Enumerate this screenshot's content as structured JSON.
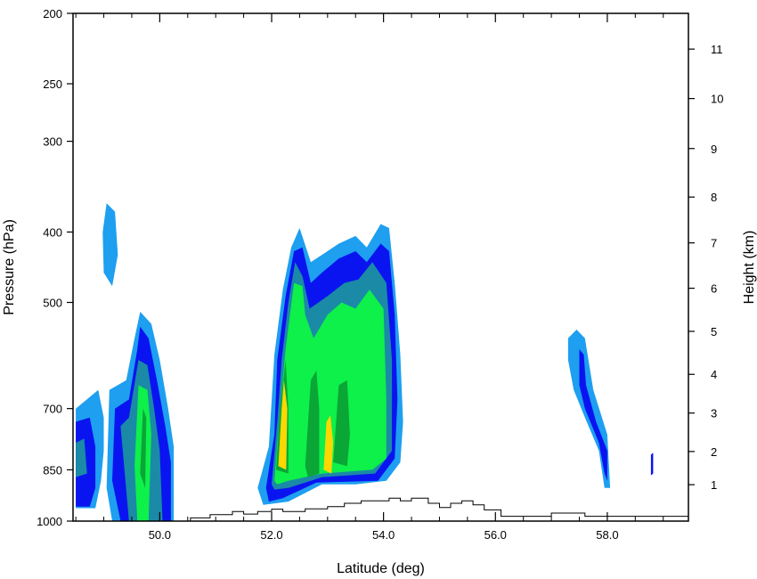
{
  "chart_data": {
    "type": "heatmap",
    "title": "",
    "xlabel": "Latitude (deg)",
    "ylabel": "Pressure (hPa)",
    "y2label": "Height (km)",
    "xlim": [
      48.45,
      59.45
    ],
    "ylim": [
      1000,
      200
    ],
    "y_scale": "log",
    "x_ticks": [
      {
        "value": 50,
        "label": "50.0"
      },
      {
        "value": 52,
        "label": "52.0"
      },
      {
        "value": 54,
        "label": "54.0"
      },
      {
        "value": 56,
        "label": "56.0"
      },
      {
        "value": 58,
        "label": "58.0"
      }
    ],
    "y_ticks": [
      {
        "value": 1000,
        "label": "1000"
      },
      {
        "value": 850,
        "label": "850"
      },
      {
        "value": 700,
        "label": "700"
      },
      {
        "value": 500,
        "label": "500"
      },
      {
        "value": 400,
        "label": "400"
      },
      {
        "value": 300,
        "label": "300"
      },
      {
        "value": 250,
        "label": "250"
      },
      {
        "value": 200,
        "label": "200"
      }
    ],
    "y2_ticks": [
      {
        "value": 1,
        "label": "1"
      },
      {
        "value": 2,
        "label": "2"
      },
      {
        "value": 3,
        "label": "3"
      },
      {
        "value": 4,
        "label": "4"
      },
      {
        "value": 5,
        "label": "5"
      },
      {
        "value": 6,
        "label": "6"
      },
      {
        "value": 7,
        "label": "7"
      },
      {
        "value": 8,
        "label": "8"
      },
      {
        "value": 9,
        "label": "9"
      },
      {
        "value": 10,
        "label": "10"
      },
      {
        "value": 11,
        "label": "11"
      }
    ],
    "height_pressure_map": [
      {
        "km": 1,
        "hPa": 891
      },
      {
        "km": 2,
        "hPa": 802
      },
      {
        "km": 3,
        "hPa": 710
      },
      {
        "km": 4,
        "hPa": 628
      },
      {
        "km": 5,
        "hPa": 548
      },
      {
        "km": 6,
        "hPa": 478
      },
      {
        "km": 7,
        "hPa": 414
      },
      {
        "km": 8,
        "hPa": 358
      },
      {
        "km": 9,
        "hPa": 307
      },
      {
        "km": 10,
        "hPa": 262
      },
      {
        "km": 11,
        "hPa": 224
      }
    ],
    "fill_levels": [
      {
        "color": "#1e9ff0"
      },
      {
        "color": "#0a14f0"
      },
      {
        "color": "#1a8aa6"
      },
      {
        "color": "#0ef04a"
      },
      {
        "color": "#0aa636"
      },
      {
        "color": "#ffd700"
      }
    ],
    "regions": [
      {
        "level": 0,
        "points": [
          [
            48.5,
            700
          ],
          [
            48.9,
            660
          ],
          [
            49.0,
            720
          ],
          [
            49.0,
            800
          ],
          [
            48.95,
            880
          ],
          [
            48.85,
            960
          ],
          [
            48.5,
            960
          ]
        ]
      },
      {
        "level": 1,
        "points": [
          [
            48.5,
            730
          ],
          [
            48.75,
            720
          ],
          [
            48.85,
            790
          ],
          [
            48.85,
            900
          ],
          [
            48.75,
            955
          ],
          [
            48.5,
            955
          ]
        ]
      },
      {
        "level": 2,
        "points": [
          [
            48.5,
            780
          ],
          [
            48.65,
            770
          ],
          [
            48.7,
            860
          ],
          [
            48.5,
            870
          ]
        ]
      },
      {
        "level": 0,
        "points": [
          [
            49.05,
            365
          ],
          [
            49.2,
            375
          ],
          [
            49.25,
            430
          ],
          [
            49.15,
            475
          ],
          [
            49.0,
            455
          ],
          [
            48.98,
            400
          ]
        ]
      },
      {
        "level": 0,
        "points": [
          [
            49.1,
            660
          ],
          [
            49.4,
            640
          ],
          [
            49.55,
            560
          ],
          [
            49.65,
            515
          ],
          [
            49.85,
            535
          ],
          [
            50.0,
            600
          ],
          [
            50.15,
            700
          ],
          [
            50.25,
            790
          ],
          [
            50.25,
            1000
          ],
          [
            49.15,
            1000
          ],
          [
            49.05,
            900
          ]
        ]
      },
      {
        "level": 1,
        "points": [
          [
            49.2,
            700
          ],
          [
            49.45,
            680
          ],
          [
            49.6,
            580
          ],
          [
            49.65,
            540
          ],
          [
            49.8,
            560
          ],
          [
            49.95,
            640
          ],
          [
            50.1,
            740
          ],
          [
            50.2,
            830
          ],
          [
            50.2,
            1000
          ],
          [
            49.3,
            1000
          ],
          [
            49.15,
            880
          ]
        ]
      },
      {
        "level": 2,
        "points": [
          [
            49.3,
            740
          ],
          [
            49.45,
            720
          ],
          [
            49.62,
            600
          ],
          [
            49.78,
            610
          ],
          [
            49.9,
            700
          ],
          [
            50.0,
            800
          ],
          [
            50.05,
            1000
          ],
          [
            49.45,
            1000
          ]
        ]
      },
      {
        "level": 3,
        "points": [
          [
            49.55,
            840
          ],
          [
            49.62,
            650
          ],
          [
            49.78,
            660
          ],
          [
            49.85,
            760
          ],
          [
            49.8,
            1000
          ],
          [
            49.6,
            1000
          ]
        ]
      },
      {
        "level": 4,
        "points": [
          [
            49.65,
            860
          ],
          [
            49.7,
            700
          ],
          [
            49.76,
            720
          ],
          [
            49.74,
            900
          ]
        ]
      },
      {
        "level": 0,
        "points": [
          [
            51.75,
            900
          ],
          [
            51.95,
            790
          ],
          [
            52.05,
            590
          ],
          [
            52.2,
            480
          ],
          [
            52.35,
            420
          ],
          [
            52.5,
            395
          ],
          [
            52.7,
            440
          ],
          [
            52.9,
            430
          ],
          [
            53.2,
            415
          ],
          [
            53.5,
            405
          ],
          [
            53.7,
            420
          ],
          [
            53.95,
            390
          ],
          [
            54.1,
            395
          ],
          [
            54.2,
            470
          ],
          [
            54.3,
            590
          ],
          [
            54.35,
            730
          ],
          [
            54.3,
            830
          ],
          [
            54.05,
            880
          ],
          [
            53.5,
            890
          ],
          [
            52.9,
            890
          ],
          [
            52.3,
            940
          ],
          [
            51.85,
            950
          ]
        ]
      },
      {
        "level": 1,
        "points": [
          [
            51.9,
            900
          ],
          [
            52.05,
            760
          ],
          [
            52.1,
            600
          ],
          [
            52.25,
            490
          ],
          [
            52.4,
            425
          ],
          [
            52.55,
            420
          ],
          [
            52.7,
            470
          ],
          [
            52.9,
            455
          ],
          [
            53.2,
            435
          ],
          [
            53.5,
            425
          ],
          [
            53.7,
            440
          ],
          [
            53.95,
            415
          ],
          [
            54.1,
            425
          ],
          [
            54.2,
            520
          ],
          [
            54.25,
            680
          ],
          [
            54.2,
            820
          ],
          [
            53.9,
            880
          ],
          [
            52.8,
            885
          ],
          [
            52.2,
            930
          ],
          [
            51.95,
            940
          ]
        ]
      },
      {
        "level": 2,
        "points": [
          [
            52.0,
            890
          ],
          [
            52.1,
            730
          ],
          [
            52.18,
            600
          ],
          [
            52.3,
            500
          ],
          [
            52.42,
            440
          ],
          [
            52.55,
            460
          ],
          [
            52.68,
            510
          ],
          [
            53.0,
            490
          ],
          [
            53.3,
            470
          ],
          [
            53.55,
            465
          ],
          [
            53.8,
            440
          ],
          [
            54.05,
            470
          ],
          [
            54.15,
            600
          ],
          [
            54.15,
            800
          ],
          [
            53.85,
            860
          ],
          [
            52.9,
            870
          ],
          [
            52.3,
            900
          ],
          [
            52.05,
            905
          ]
        ]
      },
      {
        "level": 3,
        "points": [
          [
            52.05,
            880
          ],
          [
            52.15,
            700
          ],
          [
            52.25,
            580
          ],
          [
            52.4,
            470
          ],
          [
            52.55,
            475
          ],
          [
            52.6,
            520
          ],
          [
            52.75,
            560
          ],
          [
            53.0,
            520
          ],
          [
            53.25,
            500
          ],
          [
            53.5,
            510
          ],
          [
            53.75,
            480
          ],
          [
            54.0,
            510
          ],
          [
            54.05,
            680
          ],
          [
            54.05,
            820
          ],
          [
            53.8,
            850
          ],
          [
            52.9,
            860
          ],
          [
            52.3,
            880
          ],
          [
            52.1,
            890
          ]
        ]
      },
      {
        "level": 4,
        "points": [
          [
            52.08,
            850
          ],
          [
            52.15,
            700
          ],
          [
            52.25,
            600
          ],
          [
            52.3,
            700
          ],
          [
            52.3,
            860
          ]
        ]
      },
      {
        "level": 4,
        "points": [
          [
            52.6,
            840
          ],
          [
            52.7,
            640
          ],
          [
            52.8,
            620
          ],
          [
            52.85,
            700
          ],
          [
            52.85,
            860
          ],
          [
            52.65,
            870
          ]
        ]
      },
      {
        "level": 4,
        "points": [
          [
            53.1,
            830
          ],
          [
            53.2,
            650
          ],
          [
            53.35,
            640
          ],
          [
            53.4,
            760
          ],
          [
            53.35,
            840
          ]
        ]
      },
      {
        "level": 5,
        "points": [
          [
            52.12,
            840
          ],
          [
            52.18,
            700
          ],
          [
            52.22,
            640
          ],
          [
            52.28,
            700
          ],
          [
            52.26,
            850
          ]
        ]
      },
      {
        "level": 5,
        "points": [
          [
            52.93,
            850
          ],
          [
            52.98,
            730
          ],
          [
            53.05,
            715
          ],
          [
            53.1,
            780
          ],
          [
            53.07,
            860
          ]
        ]
      },
      {
        "level": 0,
        "points": [
          [
            57.3,
            560
          ],
          [
            57.45,
            545
          ],
          [
            57.6,
            560
          ],
          [
            57.75,
            660
          ],
          [
            58.0,
            760
          ],
          [
            58.05,
            900
          ],
          [
            57.95,
            900
          ],
          [
            57.85,
            800
          ],
          [
            57.6,
            720
          ],
          [
            57.4,
            660
          ],
          [
            57.3,
            600
          ]
        ]
      },
      {
        "level": 1,
        "points": [
          [
            57.5,
            580
          ],
          [
            57.58,
            590
          ],
          [
            57.62,
            650
          ],
          [
            57.8,
            730
          ],
          [
            58.0,
            800
          ],
          [
            58.0,
            880
          ],
          [
            57.95,
            860
          ],
          [
            57.85,
            780
          ],
          [
            57.6,
            700
          ],
          [
            57.5,
            650
          ]
        ]
      },
      {
        "level": 1,
        "points": [
          [
            58.78,
            810
          ],
          [
            58.82,
            805
          ],
          [
            58.82,
            860
          ],
          [
            58.78,
            865
          ]
        ]
      }
    ],
    "terrain": [
      [
        50.55,
        1000
      ],
      [
        50.55,
        990
      ],
      [
        50.9,
        990
      ],
      [
        50.9,
        980
      ],
      [
        51.3,
        980
      ],
      [
        51.3,
        970
      ],
      [
        51.5,
        970
      ],
      [
        51.5,
        978
      ],
      [
        51.75,
        978
      ],
      [
        51.75,
        970
      ],
      [
        52.0,
        970
      ],
      [
        52.0,
        963
      ],
      [
        52.2,
        963
      ],
      [
        52.2,
        970
      ],
      [
        52.6,
        970
      ],
      [
        52.6,
        962
      ],
      [
        53.0,
        962
      ],
      [
        53.0,
        955
      ],
      [
        53.3,
        955
      ],
      [
        53.3,
        945
      ],
      [
        53.6,
        945
      ],
      [
        53.6,
        938
      ],
      [
        54.1,
        938
      ],
      [
        54.1,
        930
      ],
      [
        54.3,
        930
      ],
      [
        54.3,
        938
      ],
      [
        54.5,
        938
      ],
      [
        54.5,
        930
      ],
      [
        54.8,
        930
      ],
      [
        54.8,
        945
      ],
      [
        55.0,
        945
      ],
      [
        55.0,
        958
      ],
      [
        55.2,
        958
      ],
      [
        55.2,
        945
      ],
      [
        55.4,
        945
      ],
      [
        55.4,
        938
      ],
      [
        55.6,
        938
      ],
      [
        55.6,
        950
      ],
      [
        55.8,
        950
      ],
      [
        55.8,
        965
      ],
      [
        56.1,
        965
      ],
      [
        56.1,
        985
      ],
      [
        57.0,
        985
      ],
      [
        57.0,
        975
      ],
      [
        57.6,
        975
      ],
      [
        57.6,
        985
      ],
      [
        59.45,
        985
      ]
    ]
  }
}
